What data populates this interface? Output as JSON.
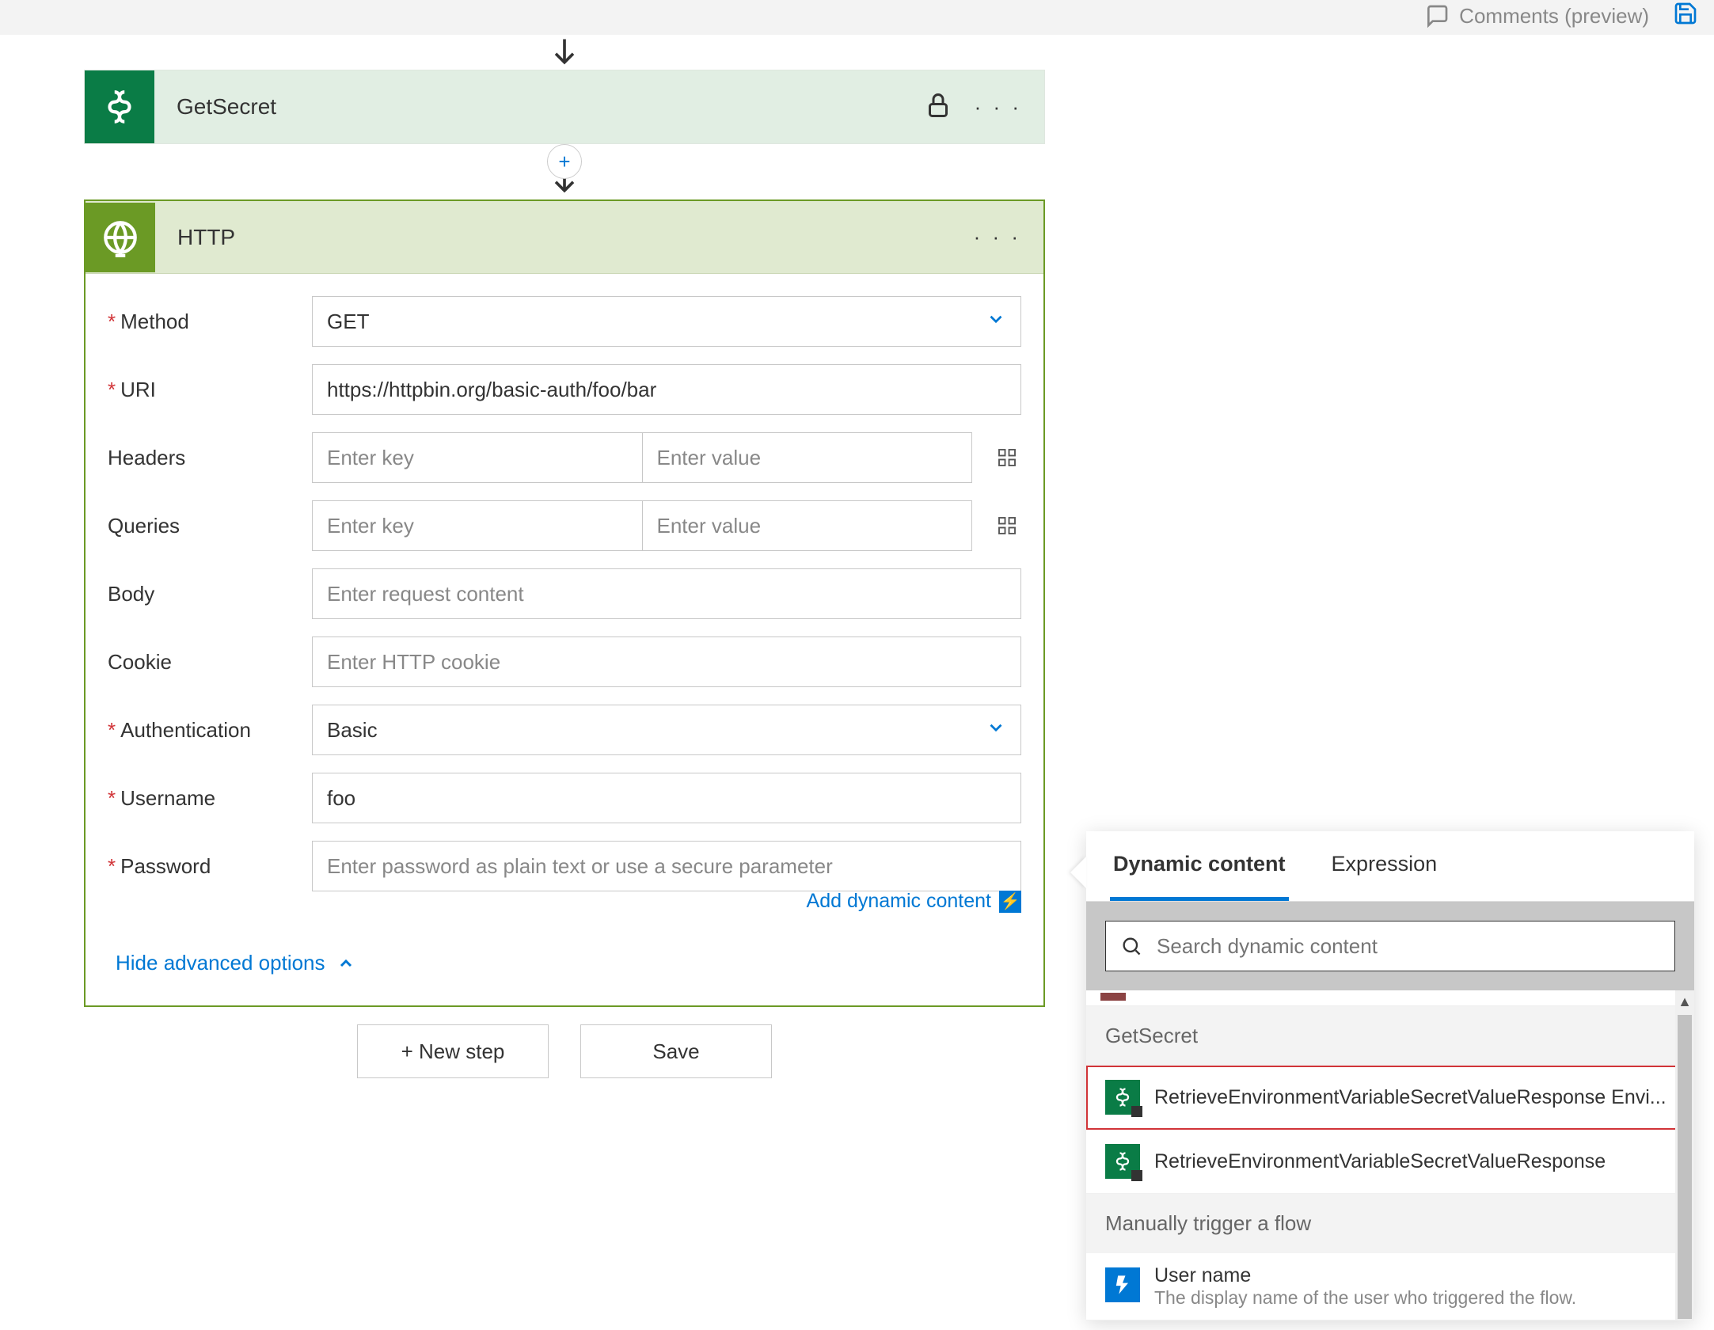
{
  "toolbar": {
    "comments_label": "Comments (preview)"
  },
  "flow": {
    "getsecret": {
      "title": "GetSecret"
    },
    "http": {
      "title": "HTTP",
      "labels": {
        "method": "Method",
        "uri": "URI",
        "headers": "Headers",
        "queries": "Queries",
        "body": "Body",
        "cookie": "Cookie",
        "authentication": "Authentication",
        "username": "Username",
        "password": "Password"
      },
      "values": {
        "method": "GET",
        "uri": "https://httpbin.org/basic-auth/foo/bar",
        "authentication": "Basic",
        "username": "foo"
      },
      "placeholders": {
        "key": "Enter key",
        "value": "Enter value",
        "body": "Enter request content",
        "cookie": "Enter HTTP cookie",
        "password": "Enter password as plain text or use a secure parameter"
      },
      "links": {
        "add_dynamic": "Add dynamic content",
        "hide_advanced": "Hide advanced options"
      }
    }
  },
  "actions": {
    "new_step": "+ New step",
    "save": "Save"
  },
  "dyn_panel": {
    "tabs": {
      "dynamic": "Dynamic content",
      "expression": "Expression"
    },
    "search_placeholder": "Search dynamic content",
    "groups": {
      "getsecret": {
        "title": "GetSecret",
        "items": [
          "RetrieveEnvironmentVariableSecretValueResponse Envi...",
          "RetrieveEnvironmentVariableSecretValueResponse"
        ]
      },
      "manual": {
        "title": "Manually trigger a flow",
        "items": [
          {
            "title": "User name",
            "desc": "The display name of the user who triggered the flow."
          }
        ]
      }
    }
  }
}
